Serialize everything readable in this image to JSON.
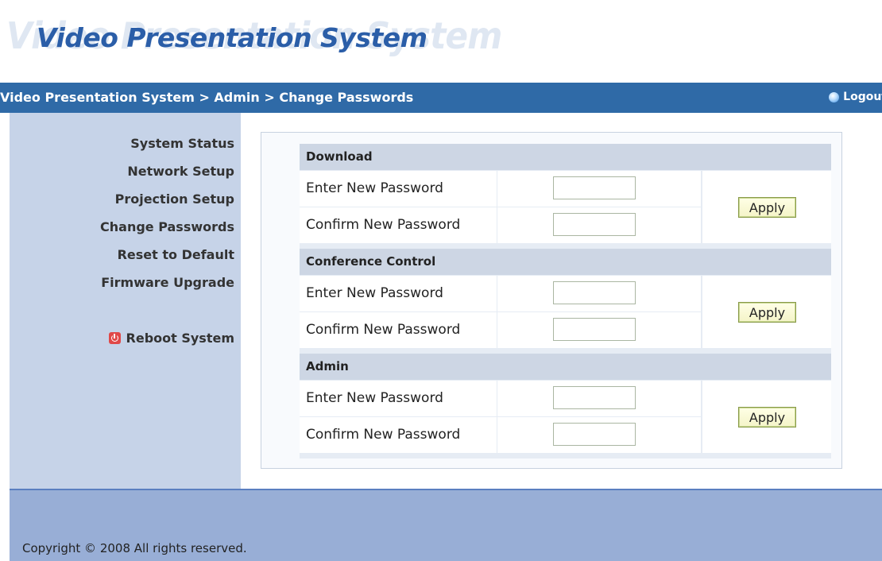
{
  "header": {
    "title_ghost": "Video Presentation System",
    "title": "Video Presentation System"
  },
  "breadcrumb": {
    "path": "Video Presentation System > Admin > Change Passwords",
    "logout_label": "Logout"
  },
  "sidebar": {
    "items": [
      {
        "label": "System Status"
      },
      {
        "label": "Network Setup"
      },
      {
        "label": "Projection Setup"
      },
      {
        "label": "Change Passwords"
      },
      {
        "label": "Reset to Default"
      },
      {
        "label": "Firmware Upgrade"
      }
    ],
    "reboot_label": "Reboot System",
    "reboot_icon": "power-icon"
  },
  "sections": [
    {
      "title": "Download",
      "enter_label": "Enter New Password",
      "enter_value": "",
      "confirm_label": "Confirm New Password",
      "confirm_value": "",
      "apply_label": "Apply"
    },
    {
      "title": "Conference Control",
      "enter_label": "Enter New Password",
      "enter_value": "",
      "confirm_label": "Confirm New Password",
      "confirm_value": "",
      "apply_label": "Apply"
    },
    {
      "title": "Admin",
      "enter_label": "Enter New Password",
      "enter_value": "",
      "confirm_label": "Confirm New Password",
      "confirm_value": "",
      "apply_label": "Apply"
    }
  ],
  "footer": {
    "copyright": "Copyright © 2008 All rights reserved."
  },
  "colors": {
    "bar": "#2f6aa7",
    "sidebar": "#c6d3e8",
    "footer": "#98aed6",
    "title": "#2b5ea8"
  }
}
